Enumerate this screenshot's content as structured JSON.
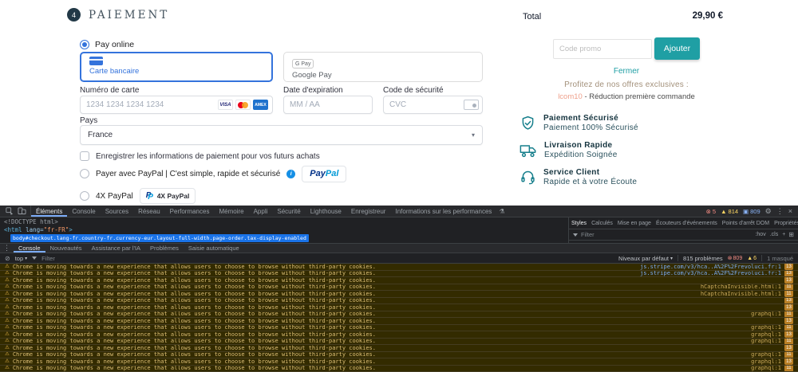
{
  "colors": {
    "teal": "#1F9FA4",
    "blue": "#3473DC",
    "selection_blue": "#1A73E8",
    "warn_bg": "#332B00",
    "warn_text": "#DCBE76",
    "link_blue": "#7CACF8",
    "link_amber": "#C9A85C",
    "badge_bg": "#B97F24",
    "promo_code": "#EFA18C",
    "offers_text": "#A3917B"
  },
  "checkout": {
    "step_number": "4",
    "section_title": "PAIEMENT",
    "pay_online_label": "Pay online",
    "methods": {
      "card": {
        "label": "Carte bancaire"
      },
      "gpay": {
        "badge": "G Pay",
        "label": "Google Pay"
      }
    },
    "card_form": {
      "number_label": "Numéro de carte",
      "number_placeholder": "1234 1234 1234 1234",
      "expiry_label": "Date d'expiration",
      "expiry_placeholder": "MM / AA",
      "cvc_label": "Code de sécurité",
      "cvc_placeholder": "CVC",
      "brand_icons": [
        "VISA",
        "Mastercard",
        "AMEX"
      ]
    },
    "country_label": "Pays",
    "country_value": "France",
    "save_info_label": "Enregistrer les informations de paiement pour vos futurs achats",
    "paypal_option_label": "Payer avec PayPal | C'est simple, rapide et sécurisé",
    "paypal_wordmark": {
      "pay": "Pay",
      "pal": "Pal"
    },
    "paypal4x_label": "4X PayPal",
    "paypal4x_badge": "4X PayPal"
  },
  "summary": {
    "total_label": "Total",
    "total_value": "29,90 €",
    "promo_placeholder": "Code promo",
    "promo_button": "Ajouter",
    "close_link": "Fermer",
    "offers_intro": "Profitez de nos offres exclusives :",
    "promo_code": "lcom10",
    "promo_desc": " - Réduction première commande",
    "features": [
      {
        "title": "Paiement Sécurisé",
        "subtitle": "Paiement 100% Sécurisé"
      },
      {
        "title": "Livraison Rapide",
        "subtitle": "Expédition Soignée"
      },
      {
        "title": "Service Client",
        "subtitle": "Rapide et à votre Écoute"
      }
    ]
  },
  "devtools": {
    "tabs": [
      "Éléments",
      "Console",
      "Sources",
      "Réseau",
      "Performances",
      "Mémoire",
      "Appli",
      "Sécurité",
      "Lighthouse",
      "Enregistreur",
      "Informations sur les performances"
    ],
    "selected_tab": "Éléments",
    "counts": {
      "errors": "5",
      "warnings": "814",
      "info": "809"
    },
    "dom": {
      "doctype": "<!DOCTYPE html>",
      "html_tag": "<html",
      "attr_name": " lang=",
      "attr_value": "\"fr-FR\"",
      "tag_close": ">",
      "selected_node": "body#checkout.lang-fr.country-fr.currency-eur.layout-full-width.page-order.tax-display-enabled"
    },
    "styles_tabs": [
      "Styles",
      "Calculés",
      "Mise en page",
      "Écouteurs d'événements",
      "Points d'arrêt DOM",
      "Propriétés"
    ],
    "styles_overflow": "»",
    "styles_filter_placeholder": "Filter",
    "styles_toolbar": [
      ":hov",
      ".cls",
      "+"
    ],
    "drawer_tabs": [
      "Console",
      "Nouveautés",
      "Assistance par l'IA",
      "Problèmes",
      "Saisie automatique"
    ],
    "console_toolbar": {
      "context": "top",
      "filter_placeholder": "Filter",
      "levels_label": "Niveaux par défaut",
      "issues_label": "815 problèmes",
      "error_count": "809",
      "warning_count": "6",
      "hidden_label": "1 masqué"
    },
    "warning_message": "Chrome is moving towards a new experience that allows users to choose to browse without third-party cookies.",
    "console_rows": [
      {
        "source": "js.stripe.com/v3/hca..A%2F%2Frevoluci.fr:1",
        "style": "blue",
        "badge": "13"
      },
      {
        "source": "js.stripe.com/v3/hca..A%2F%2Frevoluci.fr:1",
        "style": "blue",
        "badge": "13"
      },
      {
        "source": "",
        "style": "amber",
        "badge": "13"
      },
      {
        "source": "hCaptchaInvisible.html:1",
        "style": "amber",
        "badge": "11"
      },
      {
        "source": "hCaptchaInvisible.html:1",
        "style": "amber",
        "badge": "11"
      },
      {
        "source": "",
        "style": "amber",
        "badge": "13"
      },
      {
        "source": "",
        "style": "amber",
        "badge": "13"
      },
      {
        "source": "graphql:1",
        "style": "amber",
        "badge": "11"
      },
      {
        "source": "",
        "style": "amber",
        "badge": "13"
      },
      {
        "source": "graphql:1",
        "style": "amber",
        "badge": "11"
      },
      {
        "source": "graphql:1",
        "style": "amber",
        "badge": "13"
      },
      {
        "source": "graphql:1",
        "style": "amber",
        "badge": "11"
      },
      {
        "source": "",
        "style": "amber",
        "badge": "13"
      },
      {
        "source": "graphql:1",
        "style": "amber",
        "badge": "11"
      },
      {
        "source": "graphql:1",
        "style": "amber",
        "badge": "13"
      },
      {
        "source": "graphql:1",
        "style": "amber",
        "badge": "11"
      }
    ]
  }
}
